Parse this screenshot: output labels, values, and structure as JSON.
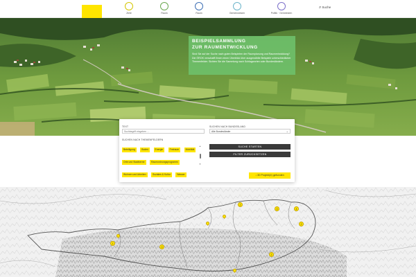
{
  "header": {
    "nav": [
      {
        "label": "Ziele",
        "color": "#d4c500"
      },
      {
        "label": "Raum",
        "color": "#6aa84f"
      },
      {
        "label": "Raum",
        "color": "#3d6fb4"
      },
      {
        "label": "Gemeinwesen",
        "color": "#6bb4c9"
      },
      {
        "label": "Politik · Gemeinden",
        "color": "#7b6fc9"
      }
    ],
    "search_label": "Suche"
  },
  "hero": {
    "title_line1": "Beispielsammlung",
    "title_line2": "zur Raumentwicklung",
    "text": "Sind Sie auf der Suche nach guten Beispielen der Raumplanung und Raumentwicklung? Die ÖROK verschafft Ihnen einen Überblick über ausgewählte Beispiele unterschiedlicher Themenfelder. Sichten Sie die Sammlung nach Schlagworten oder Bundesländern."
  },
  "filter": {
    "text_label": "Text",
    "text_placeholder": "Suchbegriff eingeben ...",
    "state_label": "Suchen nach Bundesland",
    "state_value": "Alle Bundesländer",
    "tags_label": "Suchen nach Themenfeldern",
    "tags": [
      "Beteiligung",
      "Boden",
      "Energie",
      "Freiraum",
      "Mobilität",
      "Orte und Stadtkerne",
      "Raumordnungsprogramm",
      "Wohnen und Arbeiten",
      "Soziales & Kultur",
      "Wasser"
    ],
    "search_button": "Suche starten",
    "reset_button": "Filter zurücksetzen",
    "result_count": "30 Projekt(e) gefunden"
  },
  "map": {
    "markers": [
      {
        "label": "2"
      },
      {
        "label": "3"
      },
      {
        "label": "4"
      },
      {
        "label": "2"
      },
      {
        "label": "1"
      },
      {
        "label": "3"
      },
      {
        "label": "2"
      }
    ]
  }
}
